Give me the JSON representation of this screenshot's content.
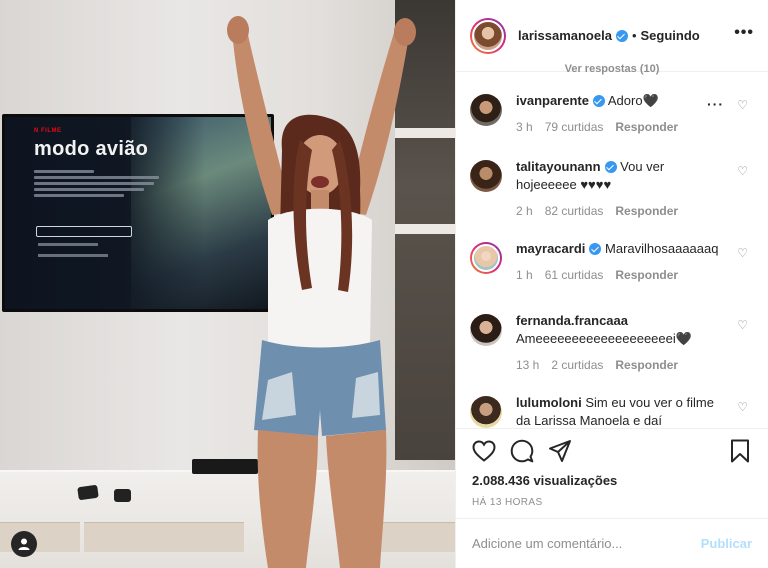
{
  "post_header": {
    "username": "larissamanoela",
    "separator": "•",
    "follow_status": "Seguindo",
    "more_label": "•••"
  },
  "video": {
    "tv_brand": "N FILME",
    "tv_title": "modo avião"
  },
  "comments": {
    "view_replies": "Ver respostas (10)",
    "items": [
      {
        "username": "ivanparente",
        "verified": true,
        "text": "Adoro🖤",
        "time": "3 h",
        "likes": "79 curtidas",
        "reply": "Responder"
      },
      {
        "username": "talitayounann",
        "verified": true,
        "text": "Vou ver hojeeeeee ♥♥♥♥",
        "time": "2 h",
        "likes": "82 curtidas",
        "reply": "Responder"
      },
      {
        "username": "mayracardi",
        "verified": true,
        "text": "Maravilhosaaaaaaq",
        "time": "1 h",
        "likes": "61 curtidas",
        "reply": "Responder"
      },
      {
        "username": "fernanda.francaaa",
        "verified": false,
        "text": "Ameeeeeeeeeeeeeeeeeeei🖤",
        "time": "13 h",
        "likes": "2 curtidas",
        "reply": "Responder"
      },
      {
        "username": "lulumoloni",
        "verified": false,
        "text": "Sim eu vou ver o filme da Larissa Manoela e daí",
        "time": "",
        "likes": "",
        "reply": ""
      }
    ]
  },
  "actions": {
    "views": "2.088.436 visualizações",
    "time_ago": "HÁ 13 HORAS"
  },
  "add_comment": {
    "placeholder": "Adicione um comentário...",
    "publish_label": "Publicar"
  },
  "colors": {
    "verified": "#3897f0",
    "publish_disabled": "#b2dffc",
    "meta_gray": "#8e8e8e"
  }
}
